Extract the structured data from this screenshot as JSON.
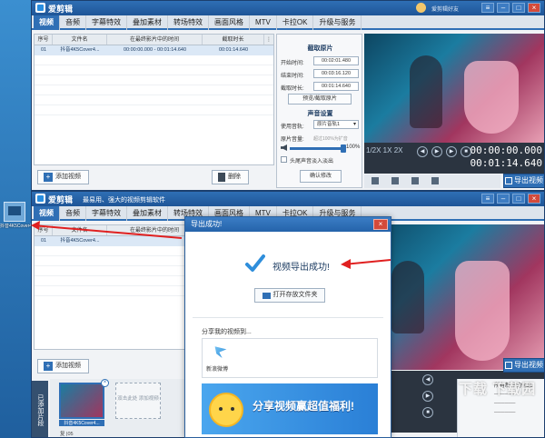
{
  "app": {
    "name": "爱剪辑",
    "slogan": "最易用、强大的视频剪辑软件",
    "user": "爱剪辑好友"
  },
  "tabs": [
    "视频",
    "音频",
    "字幕特效",
    "叠加素材",
    "转场特效",
    "画面风格",
    "MTV",
    "卡拉OK",
    "升级与服务"
  ],
  "clip_list": {
    "headers": [
      "序号",
      "文件名",
      "在最终影片中的时间",
      "截取时长"
    ],
    "rows": [
      {
        "index": "01",
        "file": "抖音4K5Cover4...",
        "time": "00:00:00.000 - 00:01:14.640",
        "duration": "00:01:14.640"
      }
    ],
    "add_label": "添加视频",
    "delete_label": "删除"
  },
  "settings": {
    "clip_title": "截取原片",
    "start_label": "开始时间:",
    "start_value": "00:02:01.480",
    "end_label": "结束时间:",
    "end_value": "00:03:16.120",
    "duration_label": "截取时长:",
    "duration_value": "00:01:14.640",
    "preview_btn": "预览/截取原片",
    "audio_title": "声音设置",
    "track_label": "使用音轨:",
    "track_value": "原片音轨1",
    "volume_label": "原片音量:",
    "volume_hint": "超过100%为扩音",
    "volume_pct": "100%",
    "fade_label": "头尾声音淡入淡出",
    "confirm_btn": "确认修改"
  },
  "player": {
    "speed": "1/2X  1X  2X",
    "time_current": "00:00:00.000",
    "time_total": "00:01:14.640",
    "export_btn": "导出视频"
  },
  "lower": {
    "added_label": "已添加片段",
    "thumb_name": "抖音4K5Cover4...",
    "thumb_dup": "复 |05",
    "empty_slot": "双击此处 添加视频",
    "right_title": "所有制作的信息:",
    "watermark": "下载 下载园"
  },
  "dialog": {
    "title": "导出成功!",
    "close": "×",
    "message": "视频导出成功!",
    "open_folder": "打开存放文件夹",
    "share_label": "分享我的视频到...",
    "weibo_label": "新浪微博",
    "banner_text": "分享视频赢超值福利!"
  },
  "desktop": {
    "icon_label": "抖音4K5Cover4"
  },
  "colors": {
    "accent": "#2f6fb5",
    "arrow": "#e02020",
    "banner": "#4aa6ee"
  }
}
